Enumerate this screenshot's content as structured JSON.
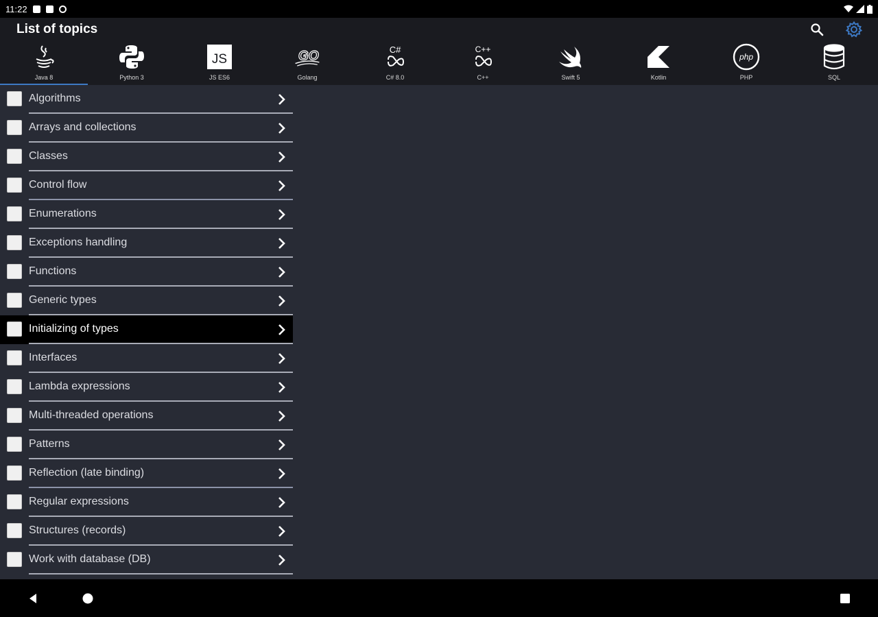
{
  "status_bar": {
    "time": "11:22"
  },
  "app_bar": {
    "title": "List of topics",
    "search_icon": "search-icon",
    "settings_icon": "gear-icon",
    "accent": "#3d79c4"
  },
  "languages": [
    {
      "label": "Java 8",
      "icon": "java-icon",
      "active": true
    },
    {
      "label": "Python 3",
      "icon": "python-icon"
    },
    {
      "label": "JS ES6",
      "icon": "js-icon",
      "logo_text": "JS"
    },
    {
      "label": "Golang",
      "icon": "golang-icon",
      "logo_text": "GO"
    },
    {
      "label": "C# 8.0",
      "icon": "csharp-icon",
      "logo_text": "C#"
    },
    {
      "label": "C++",
      "icon": "cplusplus-icon",
      "logo_text": "C++"
    },
    {
      "label": "Swift 5",
      "icon": "swift-icon"
    },
    {
      "label": "Kotlin",
      "icon": "kotlin-icon"
    },
    {
      "label": "PHP",
      "icon": "php-icon",
      "logo_text": "php"
    },
    {
      "label": "SQL",
      "icon": "database-icon"
    }
  ],
  "topics": [
    {
      "label": "Algorithms"
    },
    {
      "label": "Arrays and collections"
    },
    {
      "label": "Classes"
    },
    {
      "label": "Control flow"
    },
    {
      "label": "Enumerations"
    },
    {
      "label": "Exceptions handling"
    },
    {
      "label": "Functions"
    },
    {
      "label": "Generic types"
    },
    {
      "label": "Initializing of types",
      "selected": true
    },
    {
      "label": "Interfaces"
    },
    {
      "label": "Lambda expressions"
    },
    {
      "label": "Multi-threaded operations"
    },
    {
      "label": "Patterns"
    },
    {
      "label": "Reflection (late binding)"
    },
    {
      "label": "Regular expressions"
    },
    {
      "label": "Structures (records)"
    },
    {
      "label": "Work with database (DB)"
    }
  ],
  "nav_bar": {
    "back_icon": "back-icon",
    "home_icon": "home-icon",
    "recents_icon": "recents-icon"
  }
}
